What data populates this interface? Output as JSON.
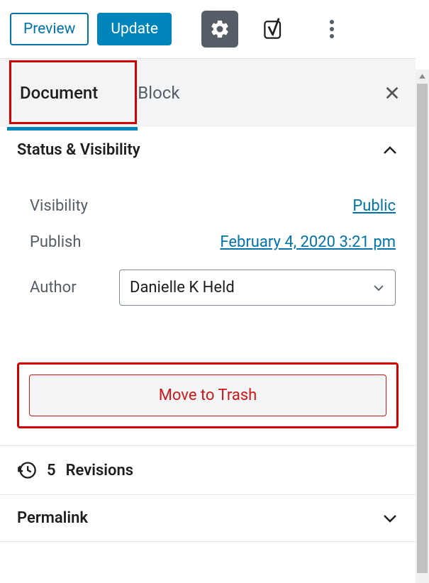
{
  "toolbar": {
    "preview_label": "Preview",
    "update_label": "Update"
  },
  "tabs": {
    "document_label": "Document",
    "block_label": "Block",
    "active": "document"
  },
  "panels": {
    "status": {
      "title": "Status & Visibility",
      "visibility_label": "Visibility",
      "visibility_value": "Public",
      "publish_label": "Publish",
      "publish_value": "February 4, 2020 3:21 pm",
      "author_label": "Author",
      "author_value": "Danielle K Held",
      "trash_label": "Move to Trash"
    },
    "revisions": {
      "count": "5",
      "label": "Revisions"
    },
    "permalink": {
      "title": "Permalink"
    }
  },
  "highlights": {
    "document_tab": true,
    "trash_button": true
  }
}
